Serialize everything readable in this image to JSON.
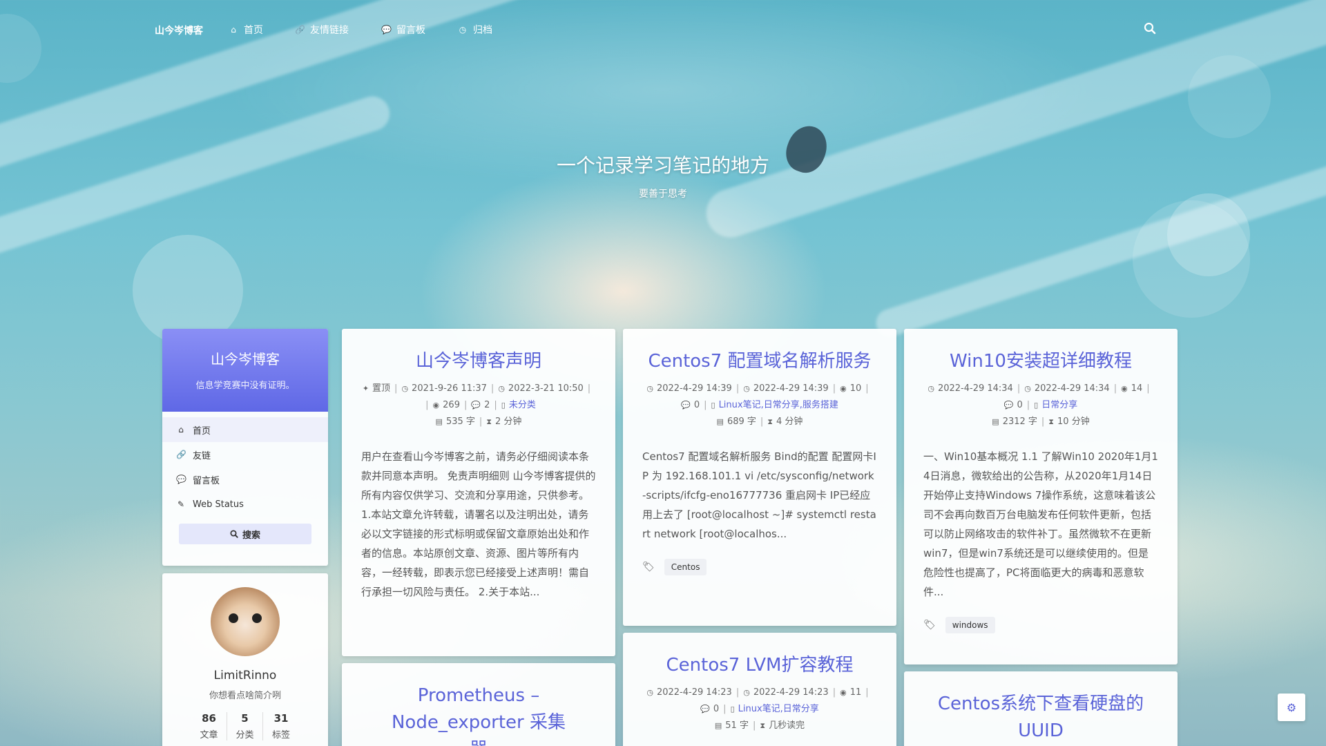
{
  "nav": {
    "brand": "山今岑博客",
    "items": [
      {
        "icon": "home-icon",
        "glyph": "⌂",
        "label": "首页"
      },
      {
        "icon": "link-icon",
        "glyph": "🔗",
        "label": "友情链接"
      },
      {
        "icon": "comment-icon",
        "glyph": "💬",
        "label": "留言板"
      },
      {
        "icon": "clock-icon",
        "glyph": "◷",
        "label": "归档"
      }
    ]
  },
  "hero": {
    "title": "一个记录学习笔记的地方",
    "subtitle": "要善于思考"
  },
  "sidebar": {
    "title": "山今岑博客",
    "description": "信息学竞赛中没有证明。",
    "menu": [
      {
        "icon": "home-icon",
        "glyph": "⌂",
        "label": "首页"
      },
      {
        "icon": "link-icon",
        "glyph": "🔗",
        "label": "友链"
      },
      {
        "icon": "comment-icon",
        "glyph": "💬",
        "label": "留言板"
      },
      {
        "icon": "status-icon",
        "glyph": "✎",
        "label": "Web Status"
      }
    ],
    "search_label": "搜索"
  },
  "author": {
    "name": "LimitRinno",
    "bio": "你想看点啥简介咧",
    "stats": [
      {
        "value": "86",
        "label": "文章"
      },
      {
        "value": "5",
        "label": "分类"
      },
      {
        "value": "31",
        "label": "标签"
      }
    ]
  },
  "posts": [
    {
      "title": "山今岑博客声明",
      "pinned": "置顶",
      "created": "2021-9-26 11:37",
      "updated": "2022-3-21 10:50",
      "views": "269",
      "comments": "2",
      "category": "未分类",
      "words": "535 字",
      "read_time": "2 分钟",
      "excerpt": "用户在查看山今岑博客之前，请务必仔细阅读本条款并同意本声明。 免责声明细则 山今岑博客提供的所有内容仅供学习、交流和分享用途，只供参考。 1.本站文章允许转载，请署名以及注明出处，请务必以文字链接的形式标明或保留文章原始出处和作者的信息。本站原创文章、资源、图片等所有内容，一经转载，即表示您已经接受上述声明！需自行承担一切风险与责任。 2.关于本站..."
    },
    {
      "title": "Prometheus – Node_exporter 采集器"
    },
    {
      "title": "Centos7 配置域名解析服务",
      "created": "2022-4-29 14:39",
      "updated": "2022-4-29 14:39",
      "views": "10",
      "comments": "0",
      "category": "Linux笔记,日常分享,服务搭建",
      "words": "689 字",
      "read_time": "4 分钟",
      "excerpt": "Centos7 配置域名解析服务 Bind的配置 配置网卡IP 为 192.168.101.1 vi /etc/sysconfig/network-scripts/ifcfg-eno16777736 重启网卡 IP已经应用上去了 [root@localhost ~]# systemctl restart network [root@localhos...",
      "tags": [
        "Centos"
      ]
    },
    {
      "title": "Centos7 LVM扩容教程",
      "created": "2022-4-29 14:23",
      "updated": "2022-4-29 14:23",
      "views": "11",
      "comments": "0",
      "category": "Linux笔记,日常分享",
      "words": "51 字",
      "read_time": "几秒读完"
    },
    {
      "title": "Win10安装超详细教程",
      "created": "2022-4-29 14:34",
      "updated": "2022-4-29 14:34",
      "views": "14",
      "comments": "0",
      "category": "日常分享",
      "words": "2312 字",
      "read_time": "10 分钟",
      "excerpt": "一、Win10基本概况 1.1 了解Win10 2020年1月14日消息，微软给出的公告称，从2020年1月14日开始停止支持Windows 7操作系统，这意味着该公司不会再向数百万台电脑发布任何软件更新，包括可以防止网络攻击的软件补丁。虽然微软不在更新win7，但是win7系统还是可以继续使用的。但是危险性也提高了，PC将面临更大的病毒和恶意软件...",
      "tags": [
        "windows"
      ]
    },
    {
      "title": "Centos系统下查看硬盘的UUID"
    }
  ],
  "colors": {
    "accent": "#5a63d8",
    "sidebar_gradient_top": "#8a8ff5",
    "sidebar_gradient_bottom": "#5f68e6"
  }
}
